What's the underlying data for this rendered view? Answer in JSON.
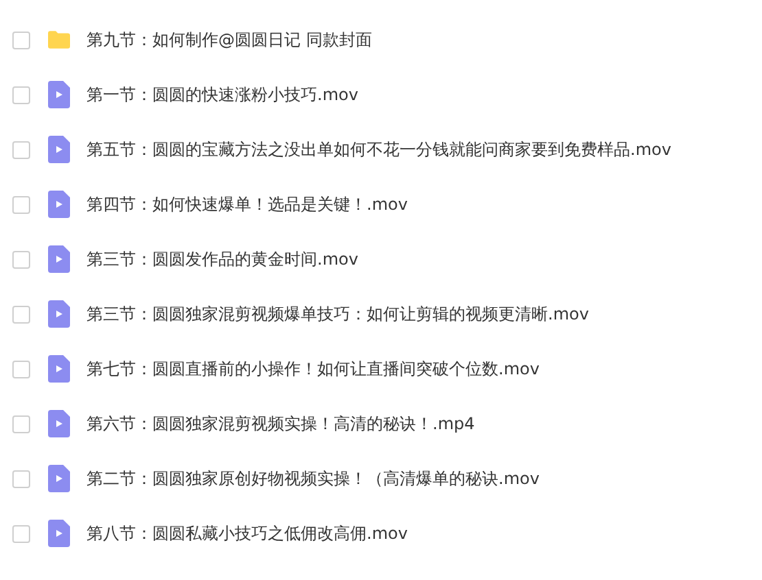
{
  "files": [
    {
      "kind": "folder",
      "name": "第九节：如何制作@圆圆日记 同款封面",
      "checked": false
    },
    {
      "kind": "video",
      "name": "第一节：圆圆的快速涨粉小技巧.mov",
      "checked": false
    },
    {
      "kind": "video",
      "name": "第五节：圆圆的宝藏方法之没出单如何不花一分钱就能问商家要到免费样品.mov",
      "checked": false
    },
    {
      "kind": "video",
      "name": "第四节：如何快速爆单！选品是关键！.mov",
      "checked": false
    },
    {
      "kind": "video",
      "name": "第三节：圆圆发作品的黄金时间.mov",
      "checked": false
    },
    {
      "kind": "video",
      "name": "第三节：圆圆独家混剪视频爆单技巧：如何让剪辑的视频更清晰.mov",
      "checked": false
    },
    {
      "kind": "video",
      "name": "第七节：圆圆直播前的小操作！如何让直播间突破个位数.mov",
      "checked": false
    },
    {
      "kind": "video",
      "name": "第六节：圆圆独家混剪视频实操！高清的秘诀！.mp4",
      "checked": false
    },
    {
      "kind": "video",
      "name": "第二节：圆圆独家原创好物视频实操！（高清爆单的秘诀.mov",
      "checked": false
    },
    {
      "kind": "video",
      "name": "第八节：圆圆私藏小技巧之低佣改高佣.mov",
      "checked": false
    }
  ]
}
